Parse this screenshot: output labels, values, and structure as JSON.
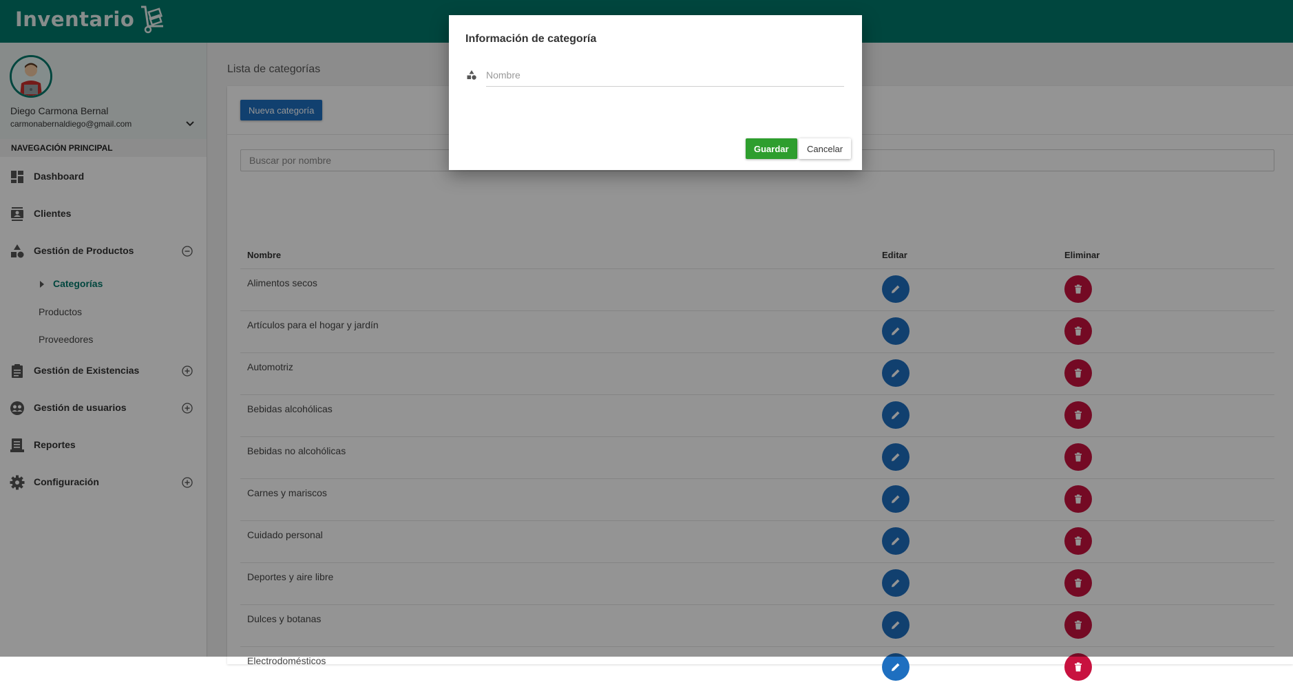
{
  "app": {
    "logo_text": "Inventario"
  },
  "user": {
    "name": "Diego Carmona Bernal",
    "email": "carmonabernaldiego@gmail.com"
  },
  "sidebar": {
    "section_title": "NAVEGACIÓN PRINCIPAL",
    "items": [
      {
        "label": "Dashboard"
      },
      {
        "label": "Clientes"
      },
      {
        "label": "Gestión de Productos",
        "expanded": true,
        "children": [
          {
            "label": "Categorías",
            "active": true
          },
          {
            "label": "Productos"
          },
          {
            "label": "Proveedores"
          }
        ]
      },
      {
        "label": "Gestión de Existencias",
        "expanded": false
      },
      {
        "label": "Gestión de usuarios",
        "expanded": false
      },
      {
        "label": "Reportes"
      },
      {
        "label": "Configuración",
        "expanded": false
      }
    ]
  },
  "main": {
    "page_title": "Lista de categorías",
    "new_button": "Nueva categoría",
    "search_placeholder": "Buscar por nombre",
    "table": {
      "headers": [
        "Nombre",
        "Editar",
        "Eliminar"
      ],
      "rows": [
        "Alimentos secos",
        "Artículos para el hogar y jardín",
        "Automotriz",
        "Bebidas alcohólicas",
        "Bebidas no alcohólicas",
        "Carnes y mariscos",
        "Cuidado personal",
        "Deportes y aire libre",
        "Dulces y botanas",
        "Electrodomésticos"
      ]
    }
  },
  "dialog": {
    "title": "Información de categoría",
    "name_placeholder": "Nombre",
    "save_label": "Guardar",
    "cancel_label": "Cancelar"
  },
  "colors": {
    "brand": "#00796b",
    "primary": "#1e6fc0",
    "danger": "#c8123f",
    "success": "#2e9e2e"
  }
}
